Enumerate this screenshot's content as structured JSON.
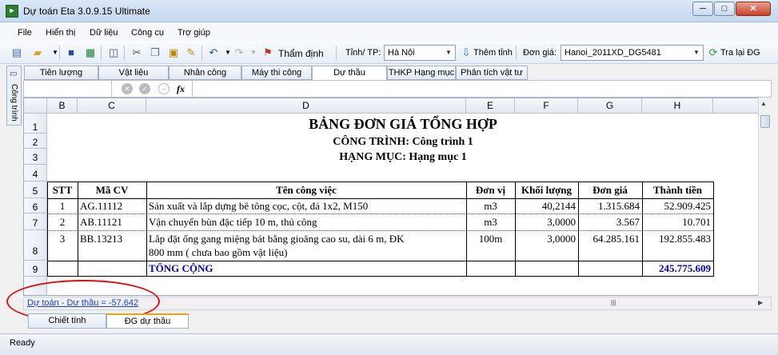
{
  "window": {
    "title": "Dự toán Eta 3.0.9.15 Ultimate",
    "app_icon": "spreadsheet-icon"
  },
  "menu": [
    "File",
    "Hiển thị",
    "Dữ liệu",
    "Công cụ",
    "Trợ giúp"
  ],
  "toolbar": {
    "tham_dinh": "Thẩm định",
    "tinh_label": "Tỉnh/ TP:",
    "tinh_value": "Hà Nội",
    "them_tinh": "Thêm tỉnh",
    "don_gia_label": "Đơn giá:",
    "don_gia_value": "Hanoi_2011XD_DG5481",
    "tra_lai": "Tra lại ĐG"
  },
  "side_tab": "Công trình",
  "tabs": [
    "Tiên lượng",
    "Vật liệu",
    "Nhân công",
    "Máy thi công",
    "Dự thầu",
    "THKP Hạng mục",
    "Phân tích vật tư"
  ],
  "active_tab": "Dự thầu",
  "formula_bar": {
    "fx": "fx"
  },
  "columns": [
    "B",
    "C",
    "D",
    "E",
    "F",
    "G",
    "H"
  ],
  "rows": [
    "1",
    "2",
    "3",
    "4",
    "5",
    "6",
    "7",
    "8",
    "9"
  ],
  "sheet": {
    "title": "BẢNG ĐƠN GIÁ TỔNG HỢP",
    "cong_trinh": "CÔNG TRÌNH: Công trình 1",
    "hang_muc": "HẠNG MỤC: Hạng mục 1",
    "headers": [
      "STT",
      "Mã CV",
      "Tên công việc",
      "Đơn vị",
      "Khối lượng",
      "Đơn giá",
      "Thành tiền"
    ],
    "items": [
      {
        "stt": "1",
        "ma": "AG.11112",
        "ten": "Sản xuất và lắp dựng bê tông cọc, cột, đá 1x2, M150",
        "don_vi": "m3",
        "khoi_luong": "40,2144",
        "don_gia": "1.315.684",
        "thanh_tien": "52.909.425"
      },
      {
        "stt": "2",
        "ma": "AB.11121",
        "ten": "Vận chuyển bùn đặc tiếp 10 m, thủ công",
        "don_vi": "m3",
        "khoi_luong": "3,0000",
        "don_gia": "3.567",
        "thanh_tien": "10.701"
      },
      {
        "stt": "3",
        "ma": "BB.13213",
        "ten_1": "Lắp đặt ống gang miệng bát bằng gioăng cao su, dài 6 m, ĐK",
        "ten_2": "800 mm ( chưa bao gồm vật liệu)",
        "don_vi": "100m",
        "khoi_luong": "3,0000",
        "don_gia": "64.285.161",
        "thanh_tien": "192.855.483"
      }
    ],
    "total_label": "TỔNG CỘNG",
    "total_value": "245.775.609"
  },
  "diff_link": "Dự toán - Dư thầu = -57.642",
  "bottom_tabs": [
    "Chiết tính",
    "ĐG dự thầu"
  ],
  "status": "Ready",
  "colors": {
    "accent_blue": "#0000cc",
    "annotation_red": "#e01010",
    "link_blue": "#1a3fd6"
  }
}
